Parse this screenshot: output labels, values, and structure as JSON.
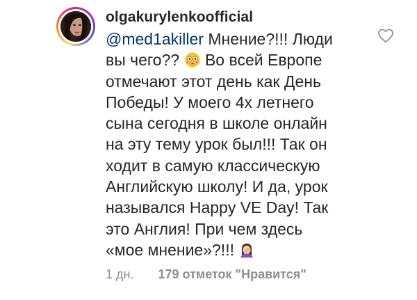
{
  "comment": {
    "username": "olgakurylenkoofficial",
    "mention": "@med1akiller",
    "segments": [
      " Мнение?!!! Люди\nвы чего?? ",
      " Во всей Европе\nотмечают этот день как День\nПобеды! У моего 4х летнего\nсына сегодня в школе онлайн\nна эту тему урок был!!! Так он\nходит в самую классическую\nАнглийскую школу! И да, урок\nназывался Happy VE Day! Так\nэто Англия! При чем здесь\n«мое мнение»?!!! "
    ],
    "emojis": [
      "flushed-face-emoji",
      "woman-facepalming-emoji"
    ],
    "time": "1 дн.",
    "likes": "179 отметок \"Нравится\"",
    "like_icon": "heart-outline-icon"
  },
  "colors": {
    "text": "#262626",
    "mention": "#00376b",
    "meta": "#8e8e8e"
  }
}
